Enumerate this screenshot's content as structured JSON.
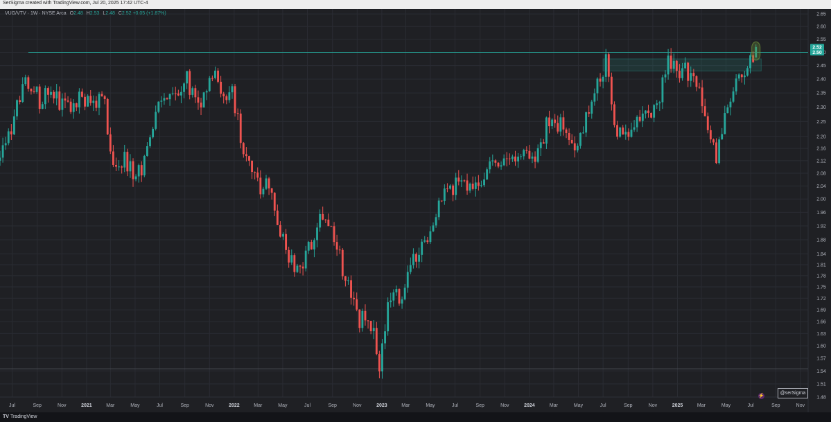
{
  "header": {
    "attribution": "SerSigma created with TradingView.com, Jul 20, 2025 17:42 UTC-4"
  },
  "legend": {
    "symbol": "VUG/VTV · 1W · NYSE Arca",
    "open_label": "O",
    "open": "2.48",
    "high_label": "H",
    "high": "2.53",
    "low_label": "L",
    "low": "2.48",
    "close_label": "C",
    "close": "2.52",
    "change": "+0.05 (+1.87%)"
  },
  "watermark": "@serSigma",
  "footer": {
    "brand": "TradingView",
    "logo_glyph": "TV"
  },
  "icons": {
    "bolt": "lightning-icon"
  },
  "colors": {
    "up": "#26a69a",
    "down": "#ef5350",
    "background": "#1f2024",
    "grid": "#2a2c33",
    "level": "#26a69a",
    "zone": "#26a69a",
    "highlight": "#6b8f3a"
  },
  "chart_data": {
    "type": "candlestick",
    "interval": "1W",
    "y_ticks": [
      "2.65",
      "2.60",
      "2.55",
      "2.50",
      "2.45",
      "2.40",
      "2.35",
      "2.30",
      "2.25",
      "2.20",
      "2.16",
      "2.12",
      "2.08",
      "2.04",
      "2.00",
      "1.96",
      "1.92",
      "1.88",
      "1.84",
      "1.81",
      "1.78",
      "1.75",
      "1.72",
      "1.69",
      "1.66",
      "1.63",
      "1.60",
      "1.57",
      "1.54",
      "1.51",
      "1.48"
    ],
    "x_ticks": [
      {
        "label": "Jul",
        "date": "2020-07-01"
      },
      {
        "label": "Sep",
        "date": "2020-09-01"
      },
      {
        "label": "Nov",
        "date": "2020-11-01"
      },
      {
        "label": "2021",
        "date": "2021-01-01",
        "bold": true
      },
      {
        "label": "Mar",
        "date": "2021-03-01"
      },
      {
        "label": "May",
        "date": "2021-05-01"
      },
      {
        "label": "Jul",
        "date": "2021-07-01"
      },
      {
        "label": "Sep",
        "date": "2021-09-01"
      },
      {
        "label": "Nov",
        "date": "2021-11-01"
      },
      {
        "label": "2022",
        "date": "2022-01-01",
        "bold": true
      },
      {
        "label": "Mar",
        "date": "2022-03-01"
      },
      {
        "label": "May",
        "date": "2022-05-01"
      },
      {
        "label": "Jul",
        "date": "2022-07-01"
      },
      {
        "label": "Sep",
        "date": "2022-09-01"
      },
      {
        "label": "Nov",
        "date": "2022-11-01"
      },
      {
        "label": "2023",
        "date": "2023-01-01",
        "bold": true
      },
      {
        "label": "Mar",
        "date": "2023-03-01"
      },
      {
        "label": "May",
        "date": "2023-05-01"
      },
      {
        "label": "Jul",
        "date": "2023-07-01"
      },
      {
        "label": "Sep",
        "date": "2023-09-01"
      },
      {
        "label": "Nov",
        "date": "2023-11-01"
      },
      {
        "label": "2024",
        "date": "2024-01-01",
        "bold": true
      },
      {
        "label": "Mar",
        "date": "2024-03-01"
      },
      {
        "label": "May",
        "date": "2024-05-01"
      },
      {
        "label": "Jul",
        "date": "2024-07-01"
      },
      {
        "label": "Sep",
        "date": "2024-09-01"
      },
      {
        "label": "Nov",
        "date": "2024-11-01"
      },
      {
        "label": "2025",
        "date": "2025-01-01",
        "bold": true
      },
      {
        "label": "Mar",
        "date": "2025-03-01"
      },
      {
        "label": "May",
        "date": "2025-05-01"
      },
      {
        "label": "Jul",
        "date": "2025-07-01"
      },
      {
        "label": "Sep",
        "date": "2025-09-01"
      },
      {
        "label": "Nov",
        "date": "2025-11-01"
      }
    ],
    "x_range": [
      "2020-06-01",
      "2025-11-20"
    ],
    "y_range": [
      1.48,
      2.67
    ],
    "log_scale": true,
    "grid": true,
    "price_labels": [
      {
        "value": 2.52,
        "text": "2.52"
      },
      {
        "value": 2.5,
        "text": "2.50"
      }
    ],
    "horizontal_levels": [
      2.5,
      1.545
    ],
    "zone": {
      "start": "2024-07-01",
      "end": "2025-07-27",
      "top": 2.475,
      "bottom": 2.43
    },
    "highlight": {
      "date": "2025-07-14",
      "top": 2.54,
      "bottom": 2.47
    },
    "anchors": [
      {
        "date": "2020-06-01",
        "price": 2.12
      },
      {
        "date": "2020-07-06",
        "price": 2.27
      },
      {
        "date": "2020-08-10",
        "price": 2.4
      },
      {
        "date": "2020-09-07",
        "price": 2.32
      },
      {
        "date": "2020-10-05",
        "price": 2.38
      },
      {
        "date": "2020-10-26",
        "price": 2.3
      },
      {
        "date": "2020-11-16",
        "price": 2.3
      },
      {
        "date": "2020-12-14",
        "price": 2.33
      },
      {
        "date": "2021-01-11",
        "price": 2.3
      },
      {
        "date": "2021-02-08",
        "price": 2.36
      },
      {
        "date": "2021-03-08",
        "price": 2.1
      },
      {
        "date": "2021-04-05",
        "price": 2.12
      },
      {
        "date": "2021-05-03",
        "price": 2.06
      },
      {
        "date": "2021-05-24",
        "price": 2.12
      },
      {
        "date": "2021-06-21",
        "price": 2.28
      },
      {
        "date": "2021-08-16",
        "price": 2.34
      },
      {
        "date": "2021-09-06",
        "price": 2.4
      },
      {
        "date": "2021-10-04",
        "price": 2.3
      },
      {
        "date": "2021-11-08",
        "price": 2.44
      },
      {
        "date": "2021-12-06",
        "price": 2.33
      },
      {
        "date": "2021-12-27",
        "price": 2.36
      },
      {
        "date": "2022-01-24",
        "price": 2.14
      },
      {
        "date": "2022-03-07",
        "price": 2.02
      },
      {
        "date": "2022-03-28",
        "price": 2.06
      },
      {
        "date": "2022-05-09",
        "price": 1.83
      },
      {
        "date": "2022-06-13",
        "price": 1.78
      },
      {
        "date": "2022-08-08",
        "price": 1.96
      },
      {
        "date": "2022-09-12",
        "price": 1.86
      },
      {
        "date": "2022-10-17",
        "price": 1.72
      },
      {
        "date": "2022-11-07",
        "price": 1.66
      },
      {
        "date": "2022-11-28",
        "price": 1.68
      },
      {
        "date": "2022-12-26",
        "price": 1.56
      },
      {
        "date": "2023-01-16",
        "price": 1.7
      },
      {
        "date": "2023-02-20",
        "price": 1.74
      },
      {
        "date": "2023-04-03",
        "price": 1.86
      },
      {
        "date": "2023-05-01",
        "price": 1.88
      },
      {
        "date": "2023-05-22",
        "price": 2.0
      },
      {
        "date": "2023-07-03",
        "price": 2.05
      },
      {
        "date": "2023-08-07",
        "price": 2.03
      },
      {
        "date": "2023-09-04",
        "price": 2.07
      },
      {
        "date": "2023-10-02",
        "price": 2.1
      },
      {
        "date": "2023-10-30",
        "price": 2.1
      },
      {
        "date": "2023-12-11",
        "price": 2.16
      },
      {
        "date": "2024-01-15",
        "price": 2.13
      },
      {
        "date": "2024-02-19",
        "price": 2.26
      },
      {
        "date": "2024-04-01",
        "price": 2.22
      },
      {
        "date": "2024-04-22",
        "price": 2.14
      },
      {
        "date": "2024-05-20",
        "price": 2.28
      },
      {
        "date": "2024-06-17",
        "price": 2.38
      },
      {
        "date": "2024-07-08",
        "price": 2.46
      },
      {
        "date": "2024-07-29",
        "price": 2.24
      },
      {
        "date": "2024-09-02",
        "price": 2.2
      },
      {
        "date": "2024-10-14",
        "price": 2.28
      },
      {
        "date": "2024-11-11",
        "price": 2.3
      },
      {
        "date": "2024-12-09",
        "price": 2.48
      },
      {
        "date": "2025-01-13",
        "price": 2.42
      },
      {
        "date": "2025-02-10",
        "price": 2.44
      },
      {
        "date": "2025-03-10",
        "price": 2.24
      },
      {
        "date": "2025-04-07",
        "price": 2.14
      },
      {
        "date": "2025-05-05",
        "price": 2.3
      },
      {
        "date": "2025-06-02",
        "price": 2.4
      },
      {
        "date": "2025-06-23",
        "price": 2.44
      },
      {
        "date": "2025-07-14",
        "price": 2.52
      }
    ]
  }
}
